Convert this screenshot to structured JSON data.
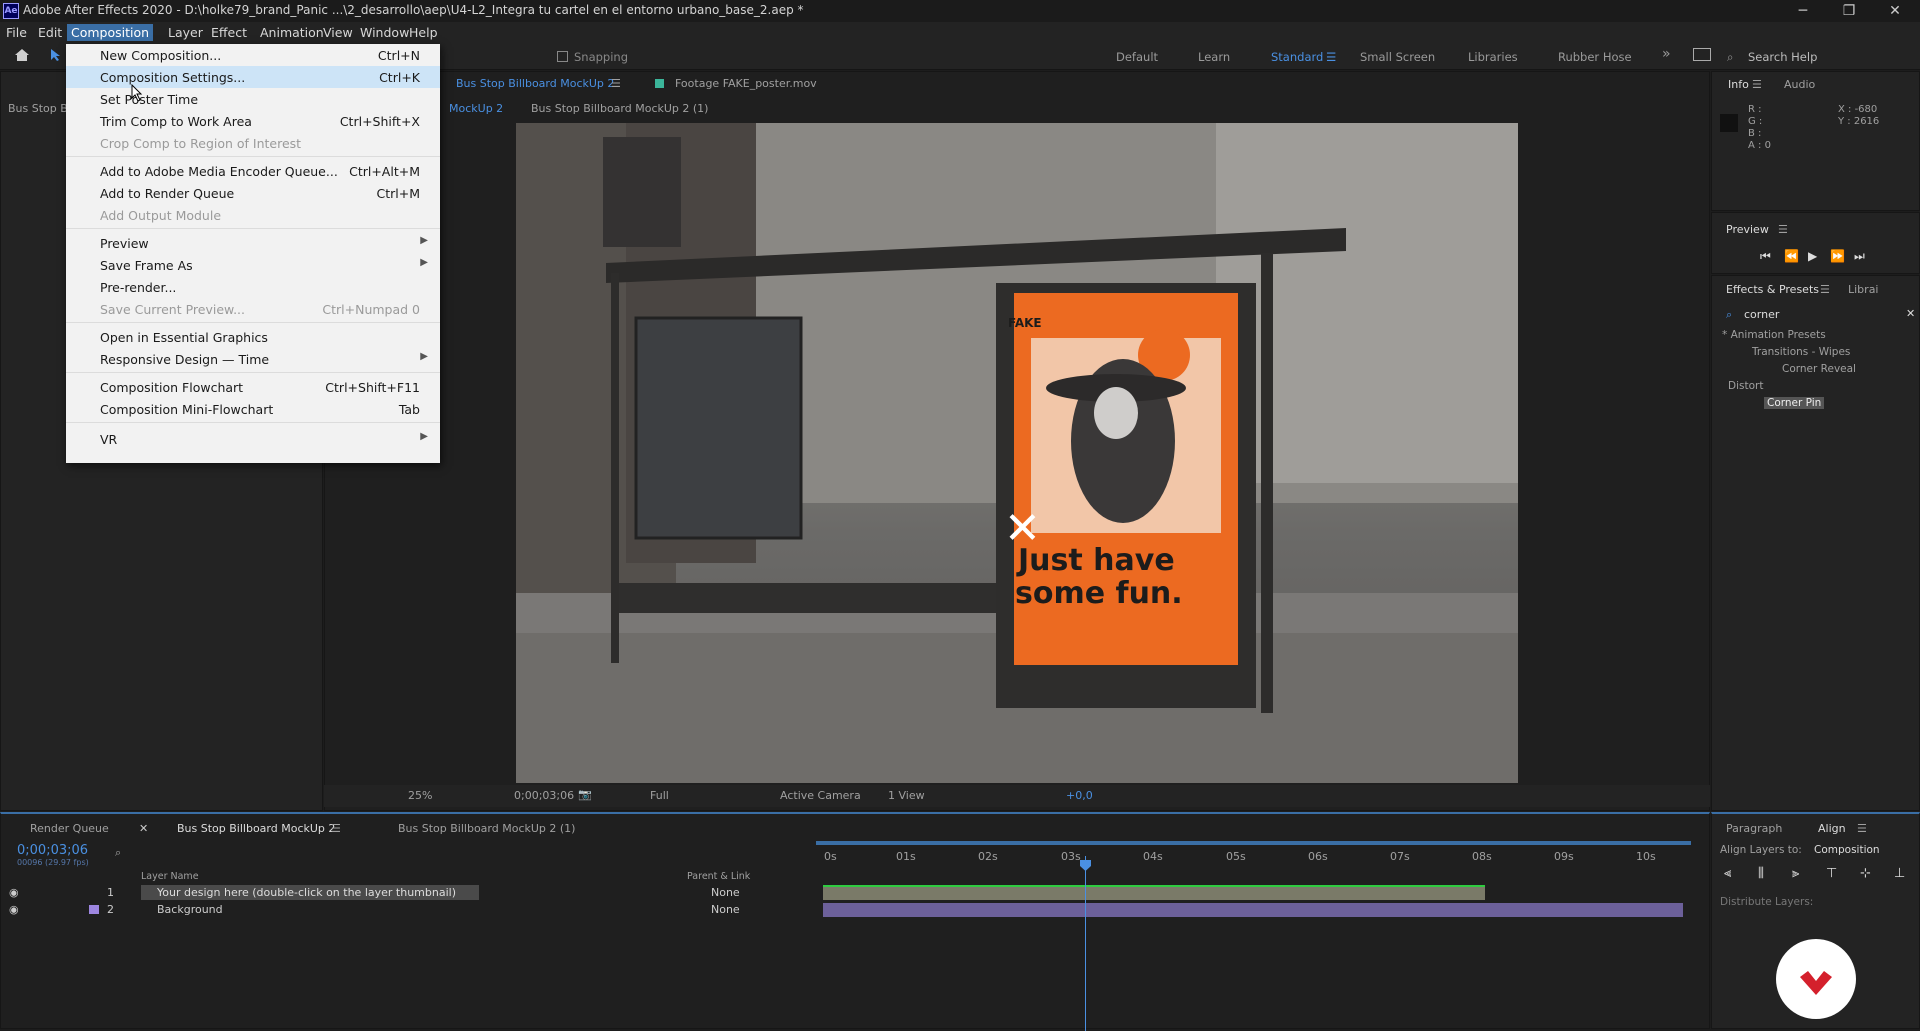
{
  "window": {
    "title": "Adobe After Effects 2020 - D:\\holke79_brand_Panic ...\\2_desarrollo\\aep\\U4-L2_Integra tu cartel en el entorno urbano_base_2.aep *",
    "app_icon": "Ae",
    "minimize": "─",
    "maximize": "❐",
    "close": "✕"
  },
  "menubar": [
    "File",
    "Edit",
    "Composition",
    "Layer",
    "Effect",
    "Animation",
    "View",
    "Window",
    "Help"
  ],
  "toolbar": {
    "snapping": "Snapping",
    "workspaces": [
      "Default",
      "Learn",
      "Standard",
      "Small Screen",
      "Libraries",
      "Rubber Hose"
    ],
    "search": "Search Help"
  },
  "composition_menu": [
    {
      "label": "New Composition...",
      "shortcut": "Ctrl+N"
    },
    {
      "label": "Composition Settings...",
      "shortcut": "Ctrl+K"
    },
    {
      "label": "Set Poster Time",
      "shortcut": ""
    },
    {
      "label": "Trim Comp to Work Area",
      "shortcut": "Ctrl+Shift+X"
    },
    {
      "label": "Crop Comp to Region of Interest",
      "shortcut": ""
    },
    {
      "label": "Add to Adobe Media Encoder Queue...",
      "shortcut": "Ctrl+Alt+M"
    },
    {
      "label": "Add to Render Queue",
      "shortcut": "Ctrl+M"
    },
    {
      "label": "Add Output Module",
      "shortcut": ""
    },
    {
      "label": "Preview",
      "shortcut": ""
    },
    {
      "label": "Save Frame As",
      "shortcut": ""
    },
    {
      "label": "Pre-render...",
      "shortcut": ""
    },
    {
      "label": "Save Current Preview...",
      "shortcut": "Ctrl+Numpad 0"
    },
    {
      "label": "Open in Essential Graphics",
      "shortcut": ""
    },
    {
      "label": "Responsive Design — Time",
      "shortcut": ""
    },
    {
      "label": "Composition Flowchart",
      "shortcut": "Ctrl+Shift+F11"
    },
    {
      "label": "Composition Mini-Flowchart",
      "shortcut": "Tab"
    },
    {
      "label": "VR",
      "shortcut": ""
    }
  ],
  "viewer": {
    "tab_comp": "Bus Stop Billboard MockUp 2",
    "tab_footage": "Footage FAKE_poster.mov",
    "breadcrumb1": "MockUp 2",
    "breadcrumb2": "Bus Stop Billboard MockUp 2 (1)",
    "project_tab": "Bus Stop Bi"
  },
  "poster": {
    "brand": "FAKE",
    "headline1": "Just have",
    "headline2": "some fun.",
    "accent": "#ec6a21"
  },
  "viewer_bar": {
    "zoom": "25%",
    "timecode": "0;00;03;06",
    "resolution": "Full",
    "camera": "Active Camera",
    "views": "1 View",
    "exposure": "+0,0"
  },
  "info": {
    "tab": "Info",
    "tab2": "Audio",
    "r": "R :",
    "g": "G :",
    "b": "B :",
    "a": "A : 0",
    "x": "X : -680",
    "y": "Y : 2616"
  },
  "preview": {
    "title": "Preview"
  },
  "effects": {
    "title": "Effects & Presets",
    "tab2": "Librai",
    "search": "corner",
    "tree": [
      "* Animation Presets",
      "Transitions - Wipes",
      "Corner Reveal",
      "Distort",
      "Corner Pin"
    ]
  },
  "timeline": {
    "tab_render": "Render Queue",
    "tab_comp": "Bus Stop Billboard MockUp 2",
    "tab_comp2": "Bus Stop Billboard MockUp 2 (1)",
    "timecode": "0;00;03;06",
    "fps": "00096 (29.97 fps)",
    "col_layer": "Layer Name",
    "col_parent": "Parent & Link",
    "layers": [
      {
        "num": "1",
        "name": "Your design here (double-click on the layer thumbnail)",
        "parent": "None"
      },
      {
        "num": "2",
        "name": "Background",
        "parent": "None"
      }
    ],
    "ticks": [
      "0s",
      "01s",
      "02s",
      "03s",
      "04s",
      "05s",
      "06s",
      "07s",
      "08s",
      "09s",
      "10s"
    ]
  },
  "align": {
    "tab_paragraph": "Paragraph",
    "tab_align": "Align",
    "align_to_label": "Align Layers to:",
    "align_to_value": "Composition",
    "distribute": "Distribute Layers:"
  }
}
